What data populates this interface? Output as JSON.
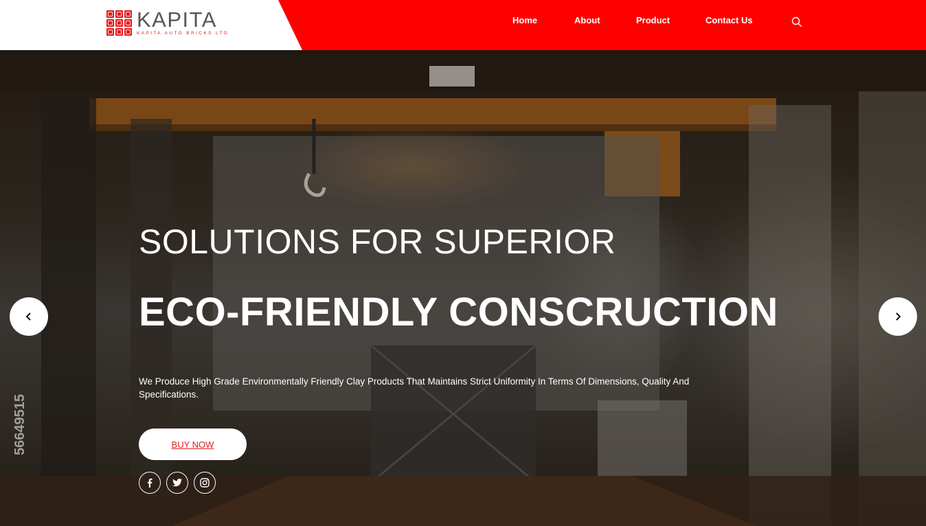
{
  "brand": {
    "name": "KAPITA",
    "tagline": "KAPITA AUTO BRICKS LTD",
    "color": "#e11d1d"
  },
  "nav": {
    "items": [
      {
        "label": "Home"
      },
      {
        "label": "About"
      },
      {
        "label": "Product"
      },
      {
        "label": "Contact Us"
      }
    ],
    "search_icon": "search-icon"
  },
  "hero": {
    "headline_line1": "SOLUTIONS FOR SUPERIOR",
    "headline_line2": "ECO-FRIENDLY CONSCRUCTION",
    "description": "We Produce High Grade Environmentally Friendly Clay Products That Maintains Strict Uniformity In Terms Of Dimensions, Quality And Specifications.",
    "cta_label": "BUY NOW",
    "social_icons": [
      "facebook-icon",
      "twitter-icon",
      "instagram-icon"
    ],
    "prev_icon": "chevron-left-icon",
    "next_icon": "chevron-right-icon",
    "watermark_text": "56649515"
  },
  "colors": {
    "header_red": "#ff0000",
    "accent": "#e11d1d",
    "white": "#ffffff"
  }
}
